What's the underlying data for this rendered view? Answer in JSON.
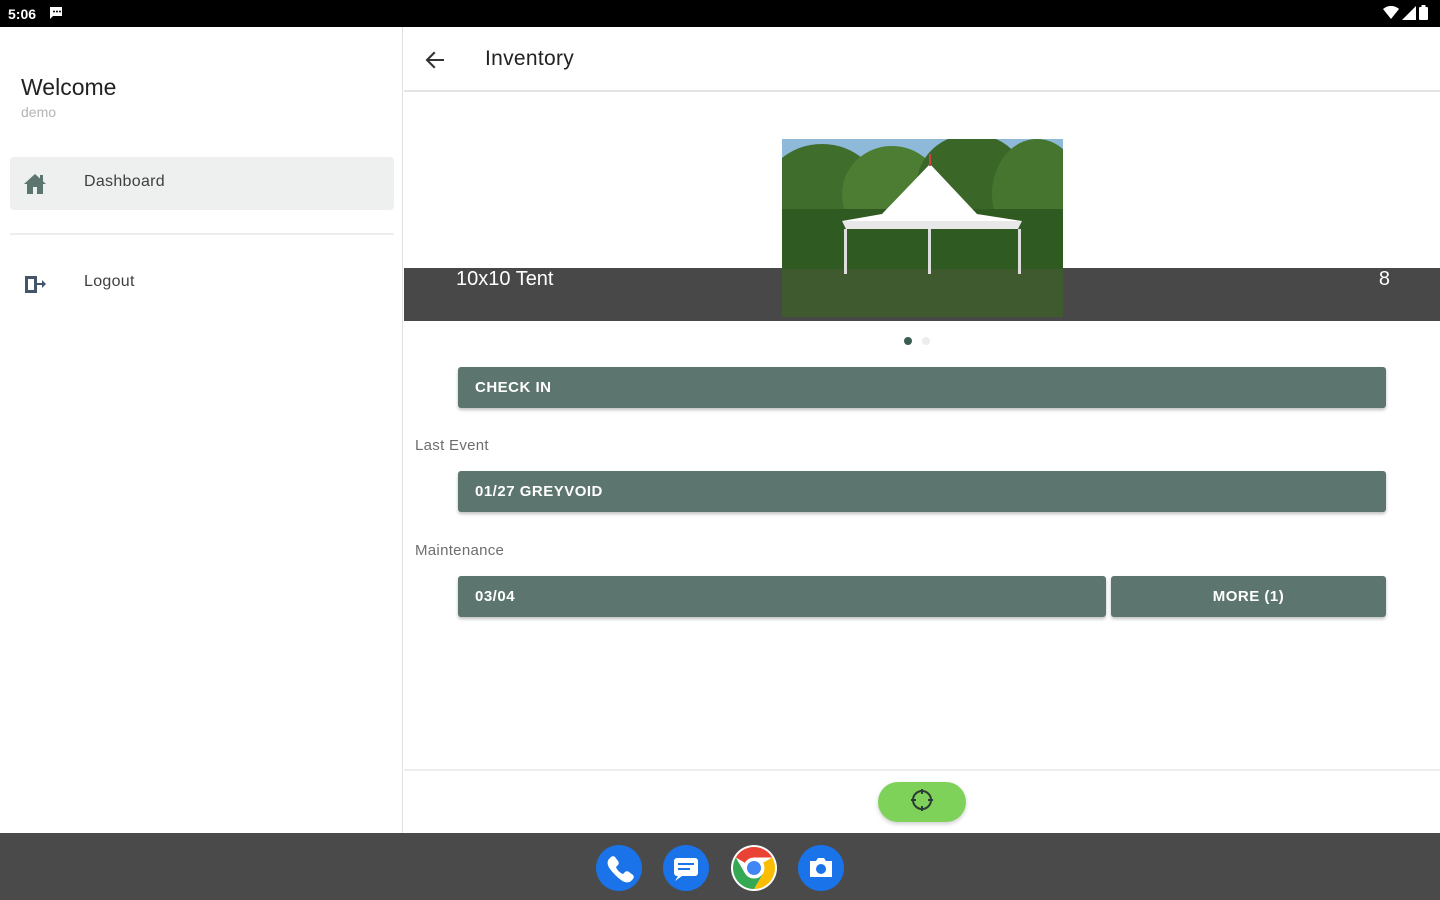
{
  "status_bar": {
    "time": "5:06"
  },
  "drawer": {
    "welcome": "Welcome",
    "username": "demo",
    "items": [
      {
        "label": "Dashboard",
        "icon": "home-icon",
        "active": true
      },
      {
        "label": "Logout",
        "icon": "logout-icon",
        "active": false
      }
    ]
  },
  "appbar": {
    "title": "Inventory"
  },
  "item": {
    "name": "10x10 Tent",
    "quantity": "8"
  },
  "carousel": {
    "pages": 2,
    "current": 1
  },
  "actions": {
    "check_in": "CHECK IN",
    "last_event_label": "Last Event",
    "last_event": "01/27 GREYVOID",
    "maintenance_label": "Maintenance",
    "maintenance_date": "03/04",
    "more": "MORE (1)"
  },
  "colors": {
    "primary": "#5c756e",
    "fab": "#7ed25a",
    "drawer_active": "#edf0ee",
    "taskbar": "#4a4a4a"
  }
}
